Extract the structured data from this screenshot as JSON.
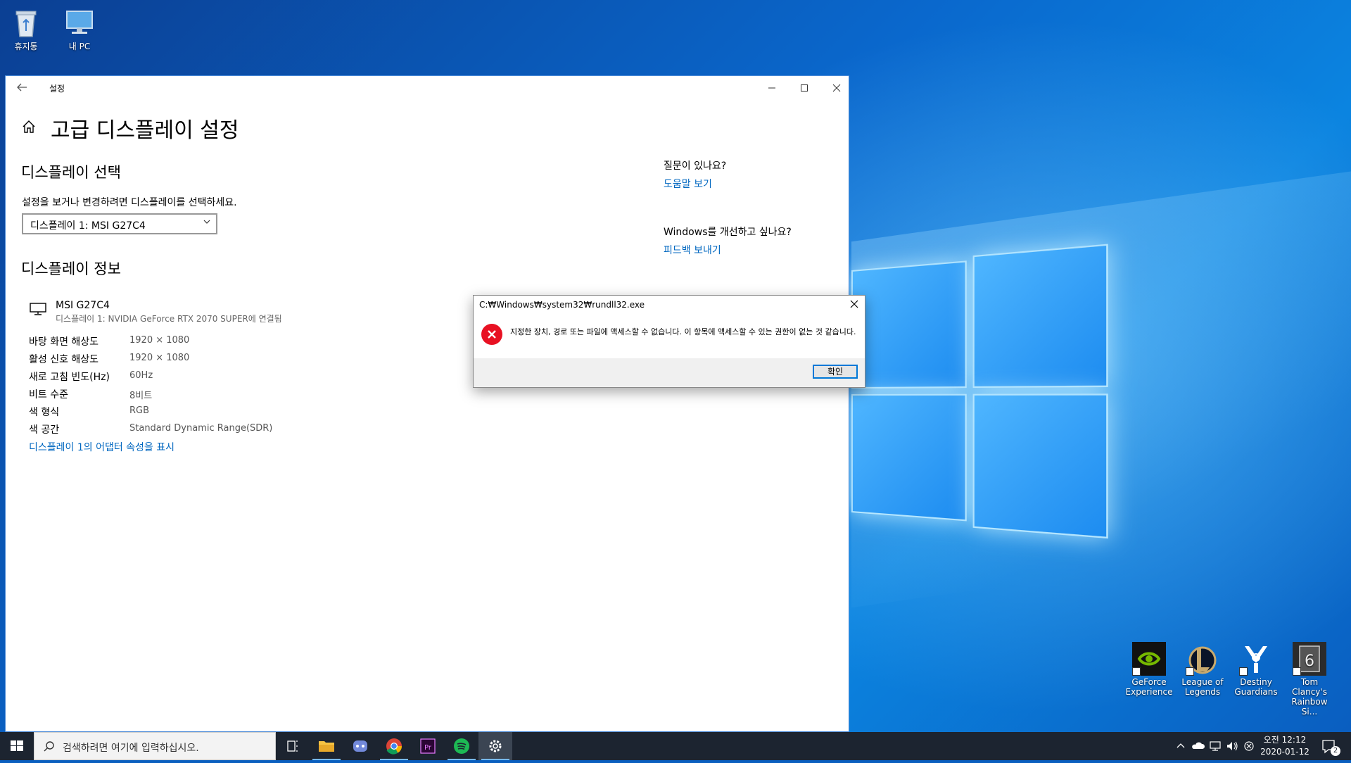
{
  "desktop": {
    "icons": [
      {
        "label": "휴지통"
      },
      {
        "label": "내 PC"
      }
    ],
    "games": [
      {
        "label": "GeForce Experience",
        "color": "#76b900"
      },
      {
        "label": "League of Legends",
        "color": "#c8aa6e"
      },
      {
        "label": "Destiny Guardians",
        "color": "#ffffff"
      },
      {
        "label": "Tom Clancy's Rainbow Si...",
        "color": "#333333"
      }
    ]
  },
  "settings": {
    "title": "설정",
    "page_title": "고급 디스플레이 설정",
    "select_heading": "디스플레이 선택",
    "select_desc": "설정을 보거나 변경하려면 디스플레이를 선택하세요.",
    "dropdown_value": "디스플레이 1: MSI G27C4",
    "info_heading": "디스플레이 정보",
    "monitor_name": "MSI G27C4",
    "monitor_sub": "디스플레이 1: NVIDIA GeForce RTX 2070 SUPER에 연결됨",
    "rows": [
      {
        "label": "바탕 화면 해상도",
        "value": "1920 × 1080"
      },
      {
        "label": "활성 신호 해상도",
        "value": "1920 × 1080"
      },
      {
        "label": "새로 고침 빈도(Hz)",
        "value": "60Hz"
      },
      {
        "label": "비트 수준",
        "value": "8비트"
      },
      {
        "label": "색 형식",
        "value": "RGB"
      },
      {
        "label": "색 공간",
        "value": "Standard Dynamic Range(SDR)"
      }
    ],
    "adapter_link": "디스플레이 1의 어댑터 속성을 표시",
    "help_q": "질문이 있나요?",
    "help_link": "도움말 보기",
    "improve_q": "Windows를 개선하고 싶나요?",
    "feedback_link": "피드백 보내기"
  },
  "dialog": {
    "title": "C:₩Windows₩system32₩rundll32.exe",
    "message": "지정한 장치, 경로 또는 파일에 액세스할 수 없습니다. 이 항목에 액세스할 수 있는 권한이 없는 것 같습니다.",
    "ok_label": "확인"
  },
  "taskbar": {
    "search_placeholder": "검색하려면 여기에 입력하십시오.",
    "time": "오전 12:12",
    "date": "2020-01-12",
    "notification_count": "2"
  },
  "colors": {
    "accent": "#0067c0",
    "error": "#e81123",
    "taskbar": "#1c2430"
  }
}
